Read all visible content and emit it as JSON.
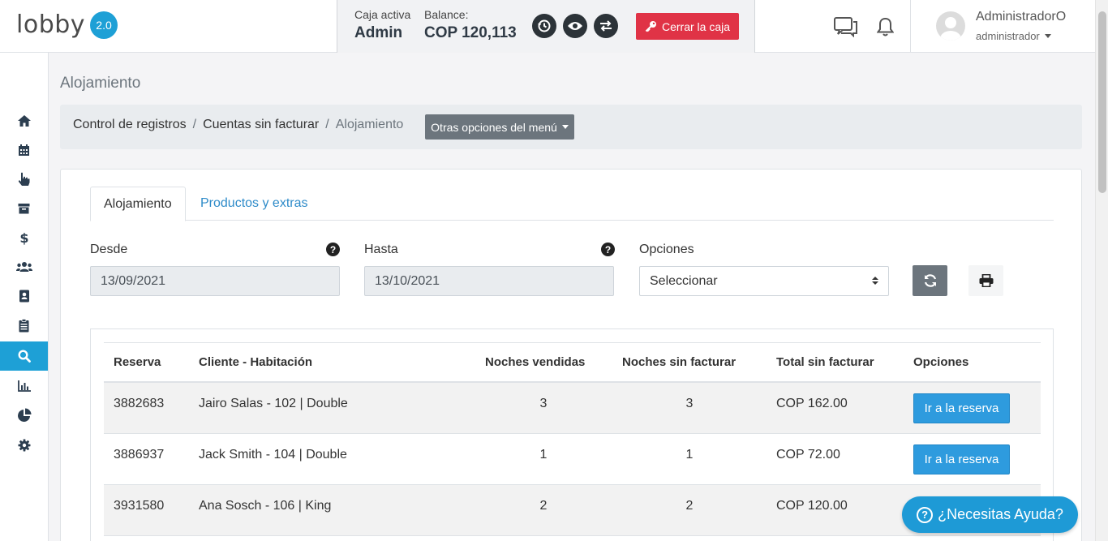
{
  "header": {
    "logo_text": "lobby",
    "logo_version": "2.0",
    "cash": {
      "active_label": "Caja activa",
      "active_value": "Admin",
      "balance_label": "Balance:",
      "balance_value": "COP 120,113",
      "close_label": "Cerrar la caja"
    },
    "user": {
      "name": "AdministradorO",
      "role": "administrador"
    }
  },
  "sidebar": {
    "items": [
      {
        "icon": "home-icon"
      },
      {
        "icon": "calendar-icon"
      },
      {
        "icon": "hand-pointer-icon"
      },
      {
        "icon": "archive-icon"
      },
      {
        "icon": "dollar-icon"
      },
      {
        "icon": "users-icon"
      },
      {
        "icon": "address-book-icon"
      },
      {
        "icon": "clipboard-icon"
      },
      {
        "icon": "search-icon",
        "active": true
      },
      {
        "icon": "bar-chart-icon"
      },
      {
        "icon": "pie-chart-icon"
      },
      {
        "icon": "gear-icon"
      }
    ],
    "accent": "#1ea0d6"
  },
  "page": {
    "title": "Alojamiento",
    "breadcrumb": [
      "Control de registros",
      "Cuentas sin facturar",
      "Alojamiento"
    ],
    "menu_button": "Otras opciones del menú"
  },
  "tabs": [
    "Alojamiento",
    "Productos y extras"
  ],
  "filters": {
    "from_label": "Desde",
    "from_value": "13/09/2021",
    "to_label": "Hasta",
    "to_value": "13/10/2021",
    "options_label": "Opciones",
    "options_value": "Seleccionar",
    "help_glyph": "?"
  },
  "table": {
    "headers": [
      "Reserva",
      "Cliente - Habitación",
      "Noches vendidas",
      "Noches sin facturar",
      "Total sin facturar",
      "Opciones"
    ],
    "rows": [
      {
        "reserva": "3882683",
        "cliente": "Jairo Salas - 102 | Double",
        "vendidas": "3",
        "sin_facturar": "3",
        "total": "COP 162.00",
        "action": "Ir a la reserva"
      },
      {
        "reserva": "3886937",
        "cliente": "Jack Smith - 104 | Double",
        "vendidas": "1",
        "sin_facturar": "1",
        "total": "COP 72.00",
        "action": "Ir a la reserva"
      },
      {
        "reserva": "3931580",
        "cliente": "Ana Sosch - 106 | King",
        "vendidas": "2",
        "sin_facturar": "2",
        "total": "COP 120.00",
        "action": ""
      }
    ]
  },
  "help_fab": {
    "label": "¿Necesitas Ayuda?",
    "glyph": "?"
  },
  "colors": {
    "primary": "#1ea0d6",
    "danger": "#e03346",
    "secondary": "#6c757d",
    "link": "#2e8bc9"
  }
}
